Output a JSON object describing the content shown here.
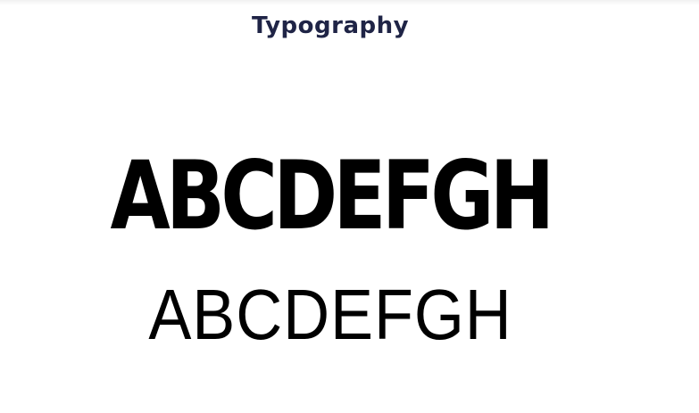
{
  "section": {
    "title": "Typography",
    "title_color": "#1f2446"
  },
  "samples": {
    "heavy": "ABCDEFGH",
    "regular": "ABCDEFGH",
    "text_color": "#000000"
  }
}
